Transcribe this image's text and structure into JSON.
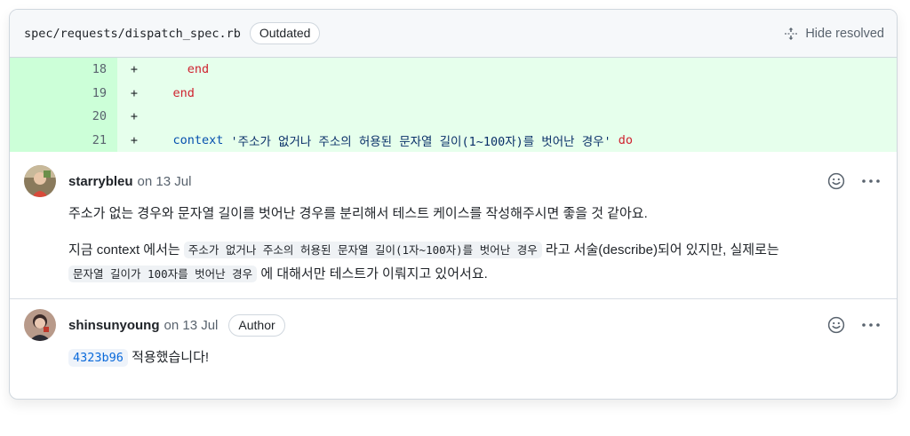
{
  "file": {
    "path": "spec/requests/dispatch_spec.rb",
    "status_badge": "Outdated",
    "hide_resolved_label": "Hide resolved"
  },
  "diff_lines": [
    {
      "num": "18",
      "sign": "+",
      "code": "      end"
    },
    {
      "num": "19",
      "sign": "+",
      "code": "    end"
    },
    {
      "num": "20",
      "sign": "+",
      "code": ""
    },
    {
      "num": "21",
      "sign": "+",
      "code_keyword": "    context",
      "code_string": " '주소가 없거나 주소의 허용된 문자열 길이(1~100자)를 벗어난 경우'",
      "code_end": " do"
    }
  ],
  "comments": [
    {
      "author": "starrybleu",
      "date": "on 13 Jul",
      "paragraph1": "주소가 없는 경우와 문자열 길이를 벗어난 경우를 분리해서 테스트 케이스를 작성해주시면 좋을 것 같아요.",
      "p2_text1": "지금 context 에서는 ",
      "p2_code1": "주소가 없거나 주소의 허용된 문자열 길이(1자~100자)를 벗어난 경우",
      "p2_text2": " 라고 서술(describe)되어 있지만, 실제로는",
      "p2_code2": "문자열 길이가 100자를 벗어난 경우",
      "p2_text3": " 에 대해서만 테스트가 이뤄지고 있어서요."
    },
    {
      "author": "shinsunyoung",
      "date": "on 13 Jul",
      "badge": "Author",
      "sha": "4323b96",
      "text": " 적용했습니다!"
    }
  ],
  "icons": {
    "hide_resolved": "unfold-icon",
    "reaction": "smiley-icon",
    "menu": "kebab-horizontal-icon"
  },
  "colors": {
    "diff_bg": "#e6ffec",
    "diff_num_bg": "#ccffd8",
    "keyword_red": "#cf222e",
    "keyword_blue": "#0550ae",
    "link_blue": "#0969da"
  }
}
